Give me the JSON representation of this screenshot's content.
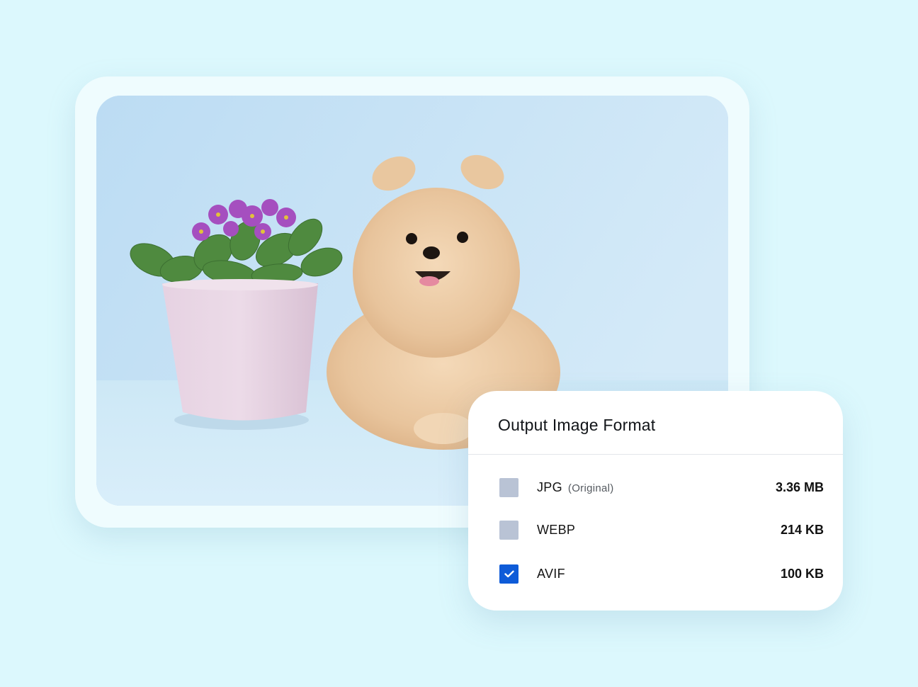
{
  "panel": {
    "title": "Output Image Format",
    "formats": [
      {
        "name": "JPG",
        "note": "(Original)",
        "size": "3.36 MB",
        "checked": false
      },
      {
        "name": "WEBP",
        "note": "",
        "size": "214 KB",
        "checked": false
      },
      {
        "name": "AVIF",
        "note": "",
        "size": "100 KB",
        "checked": true
      }
    ]
  },
  "colors": {
    "background": "#dcf8fd",
    "checked": "#0e5bd8",
    "unchecked": "#b9c3d5"
  },
  "icons": {
    "check": "check-icon"
  }
}
